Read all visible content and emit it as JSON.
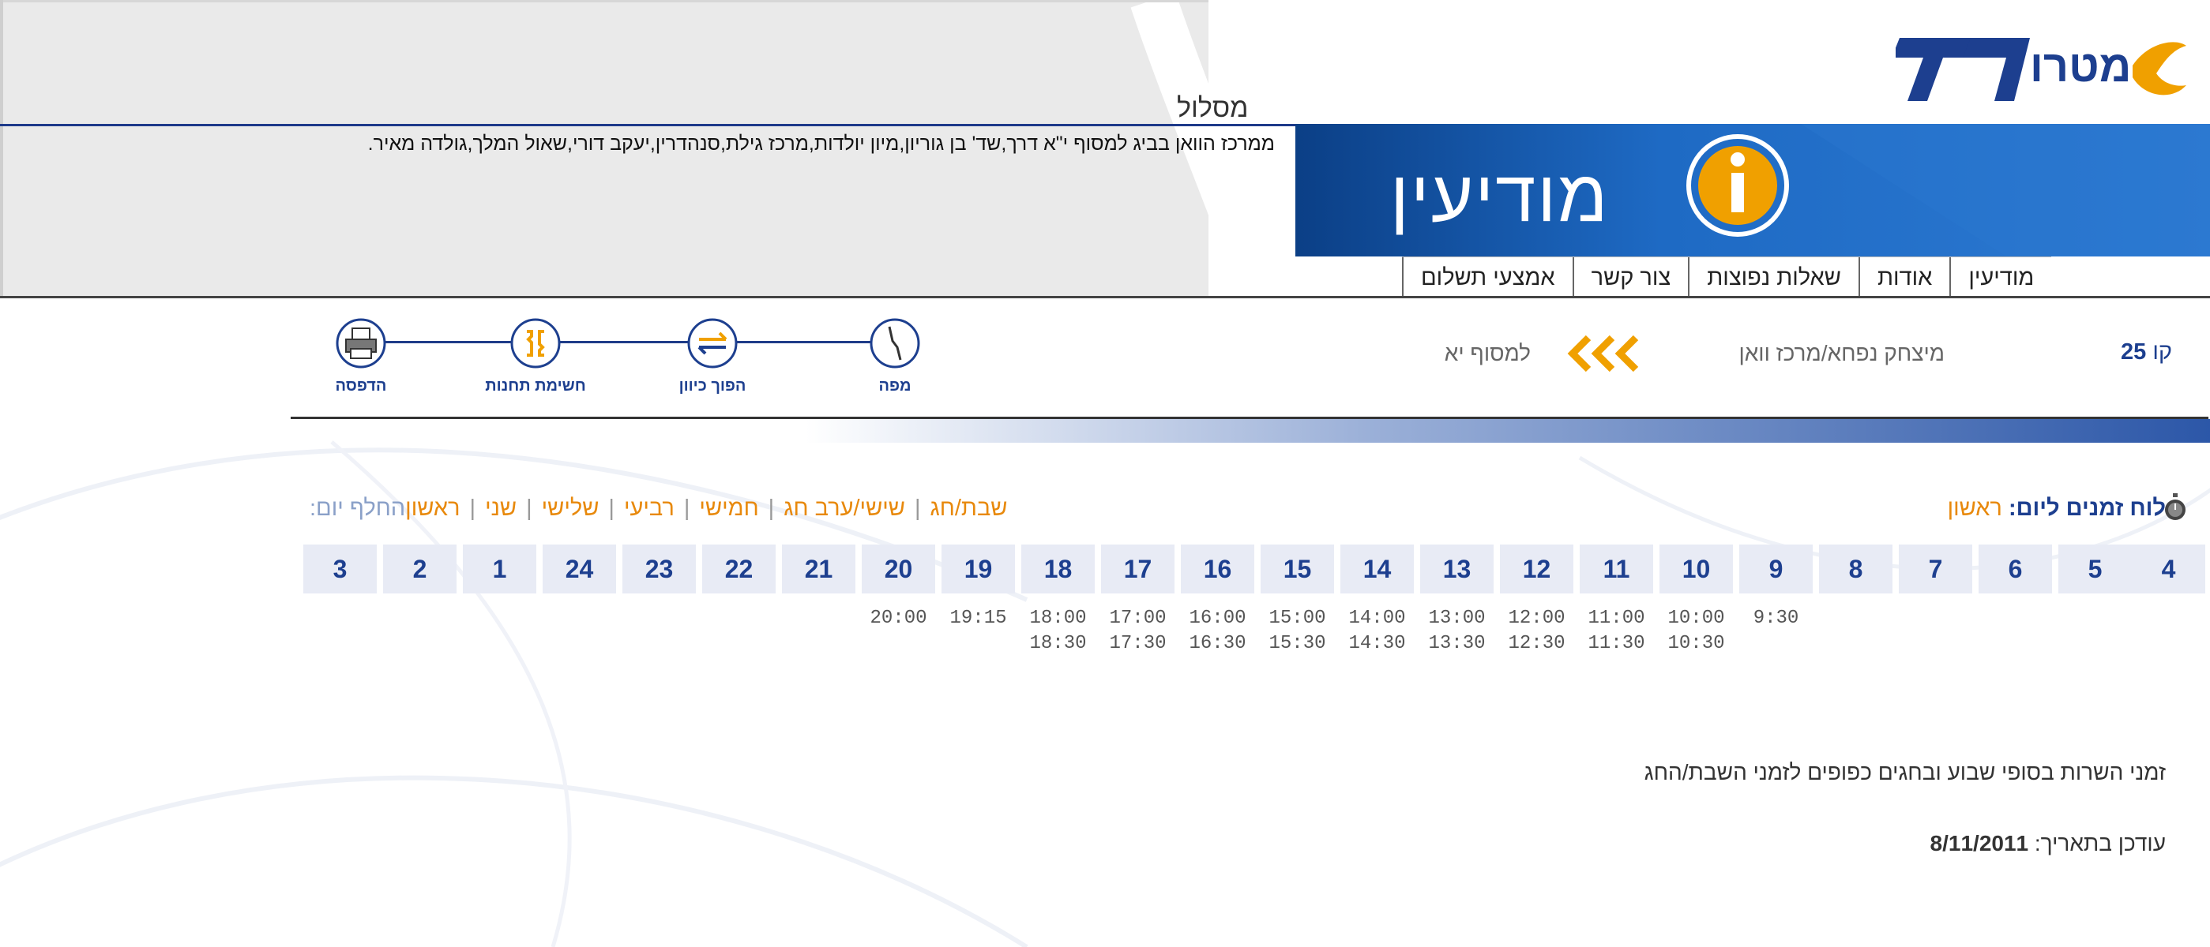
{
  "brand": {
    "logo": "metropoline-logo"
  },
  "header": {
    "route_title": "מסלול",
    "route_stops": "ממרכז הוואן בביג למסוף י\"א דרך,שד' בן גוריון,מיון יולדות,מרכז גילת,סנהדרין,יעקב דורי,שאול המלך,גולדה מאיר.",
    "banner_title": "מודיעין",
    "banner_icon": "info-icon"
  },
  "nav": {
    "items": [
      {
        "label": "מודיעין"
      },
      {
        "label": "אודות"
      },
      {
        "label": "שאלות נפוצות"
      },
      {
        "label": "צור קשר"
      },
      {
        "label": "אמצעי תשלום"
      }
    ]
  },
  "line": {
    "label": "קו",
    "number": "25",
    "origin": "מיצחק נפחא/מרכז וואן",
    "destination": "למסוף יא",
    "arrow_color": "#f0a000"
  },
  "tools": {
    "map": {
      "label": "מפה",
      "icon": "route-map-icon"
    },
    "reverse": {
      "label": "הפוך כיוון",
      "icon": "reverse-direction-icon"
    },
    "stations": {
      "label": "חשימת תחנות",
      "icon": "station-list-icon"
    },
    "print": {
      "label": "הדפסה",
      "icon": "printer-icon"
    }
  },
  "schedule": {
    "title": "לוח זמנים ליום:",
    "current_day": "ראשון",
    "change_day_label": "החלף יום:",
    "days": [
      "ראשון",
      "שני",
      "שלישי",
      "רביעי",
      "חמישי",
      "שישי/ערב חג",
      "שבת/חג"
    ],
    "hours": [
      "4",
      "5",
      "6",
      "7",
      "8",
      "9",
      "10",
      "11",
      "12",
      "13",
      "14",
      "15",
      "16",
      "17",
      "18",
      "19",
      "20",
      "21",
      "22",
      "23",
      "24",
      "1",
      "2",
      "3"
    ],
    "times": [
      [],
      [],
      [],
      [],
      [],
      [
        "9:30"
      ],
      [
        "10:00",
        "10:30"
      ],
      [
        "11:00",
        "11:30"
      ],
      [
        "12:00",
        "12:30"
      ],
      [
        "13:00",
        "13:30"
      ],
      [
        "14:00",
        "14:30"
      ],
      [
        "15:00",
        "15:30"
      ],
      [
        "16:00",
        "16:30"
      ],
      [
        "17:00",
        "17:30"
      ],
      [
        "18:00",
        "18:30"
      ],
      [
        "19:15"
      ],
      [
        "20:00"
      ],
      [],
      [],
      [],
      [],
      [],
      [],
      []
    ]
  },
  "notes": {
    "weekend": "זמני השרות בסופי שבוע ובחגים כפופים לזמני השבת/החג",
    "updated_label": "עודכן בתאריך:",
    "updated_date": "8/11/2011"
  },
  "colors": {
    "accent": "#1d3f8f",
    "orange": "#e8890c",
    "hour_bg": "#e8ebf5"
  }
}
